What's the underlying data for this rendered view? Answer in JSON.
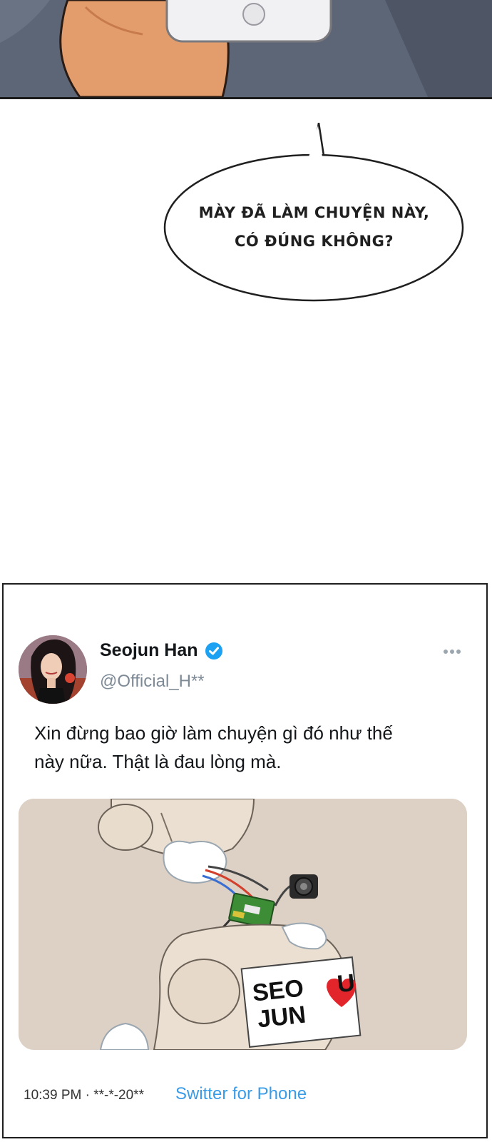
{
  "speech_bubble": {
    "line1": "Mày đã làm chuyện này,",
    "line2": "có đúng không?"
  },
  "tweet": {
    "display_name": "Seojun Han",
    "handle": "@Official_H**",
    "verified_icon": "verified-check-icon",
    "more_icon": "more-dots-icon",
    "text_line1": "Xin đừng bao giờ làm chuyện gì đó như thế",
    "text_line2": "này nữa. Thật là đau lòng mà.",
    "media": {
      "sign_line1_left": "SEO",
      "sign_line1_right": "U",
      "sign_line2": "JUN"
    },
    "timestamp": "10:39 PM · **-*-20**",
    "source": "Switter for Phone",
    "colors": {
      "link": "#3a9be6",
      "verified": "#1da1f2",
      "heart": "#e2242b"
    }
  }
}
